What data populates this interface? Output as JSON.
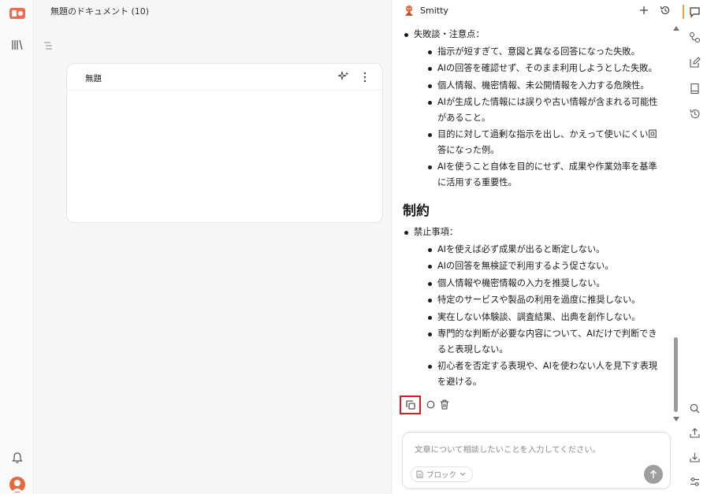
{
  "document": {
    "title": "無題のドキュメント (10)",
    "card_title": "無題"
  },
  "chat": {
    "bot_name": "Smitty",
    "section1": {
      "lead": "失敗談・注意点：",
      "items": [
        "指示が短すぎて、意図と異なる回答になった失敗。",
        "AIの回答を確認せず、そのまま利用しようとした失敗。",
        "個人情報、機密情報、未公開情報を入力する危険性。",
        "AIが生成した情報には誤りや古い情報が含まれる可能性があること。",
        "目的に対して過剰な指示を出し、かえって使いにくい回答になった例。",
        "AIを使うこと自体を目的にせず、成果や作業効率を基準に活用する重要性。"
      ]
    },
    "section2": {
      "heading": "制約",
      "lead": "禁止事項：",
      "items": [
        "AIを使えば必ず成果が出ると断定しない。",
        "AIの回答を無検証で利用するよう促さない。",
        "個人情報や機密情報の入力を推奨しない。",
        "特定のサービスや製品の利用を過度に推奨しない。",
        "実在しない体験談、調査結果、出典を創作しない。",
        "専門的な判断が必要な内容について、AIだけで判断できると表現しない。",
        "初心者を否定する表現や、AIを使わない人を見下す表現を避ける。"
      ]
    },
    "composer": {
      "placeholder": "文章について相談したいことを入力してください。",
      "block_chip": "ブロック"
    }
  },
  "icons": {
    "left_rail": [
      "app-logo-icon",
      "library-icon",
      "bell-icon",
      "user-avatar"
    ],
    "right_rail": [
      "chat-icon",
      "workflow-icon",
      "edit-icon",
      "book-icon",
      "history-icon",
      "search-icon",
      "upload-icon",
      "download-icon",
      "settings-sliders-icon"
    ]
  },
  "colors": {
    "highlight_border": "#e01919",
    "active_tab_bar": "#f0a32a",
    "avatar": "#e26a43"
  }
}
